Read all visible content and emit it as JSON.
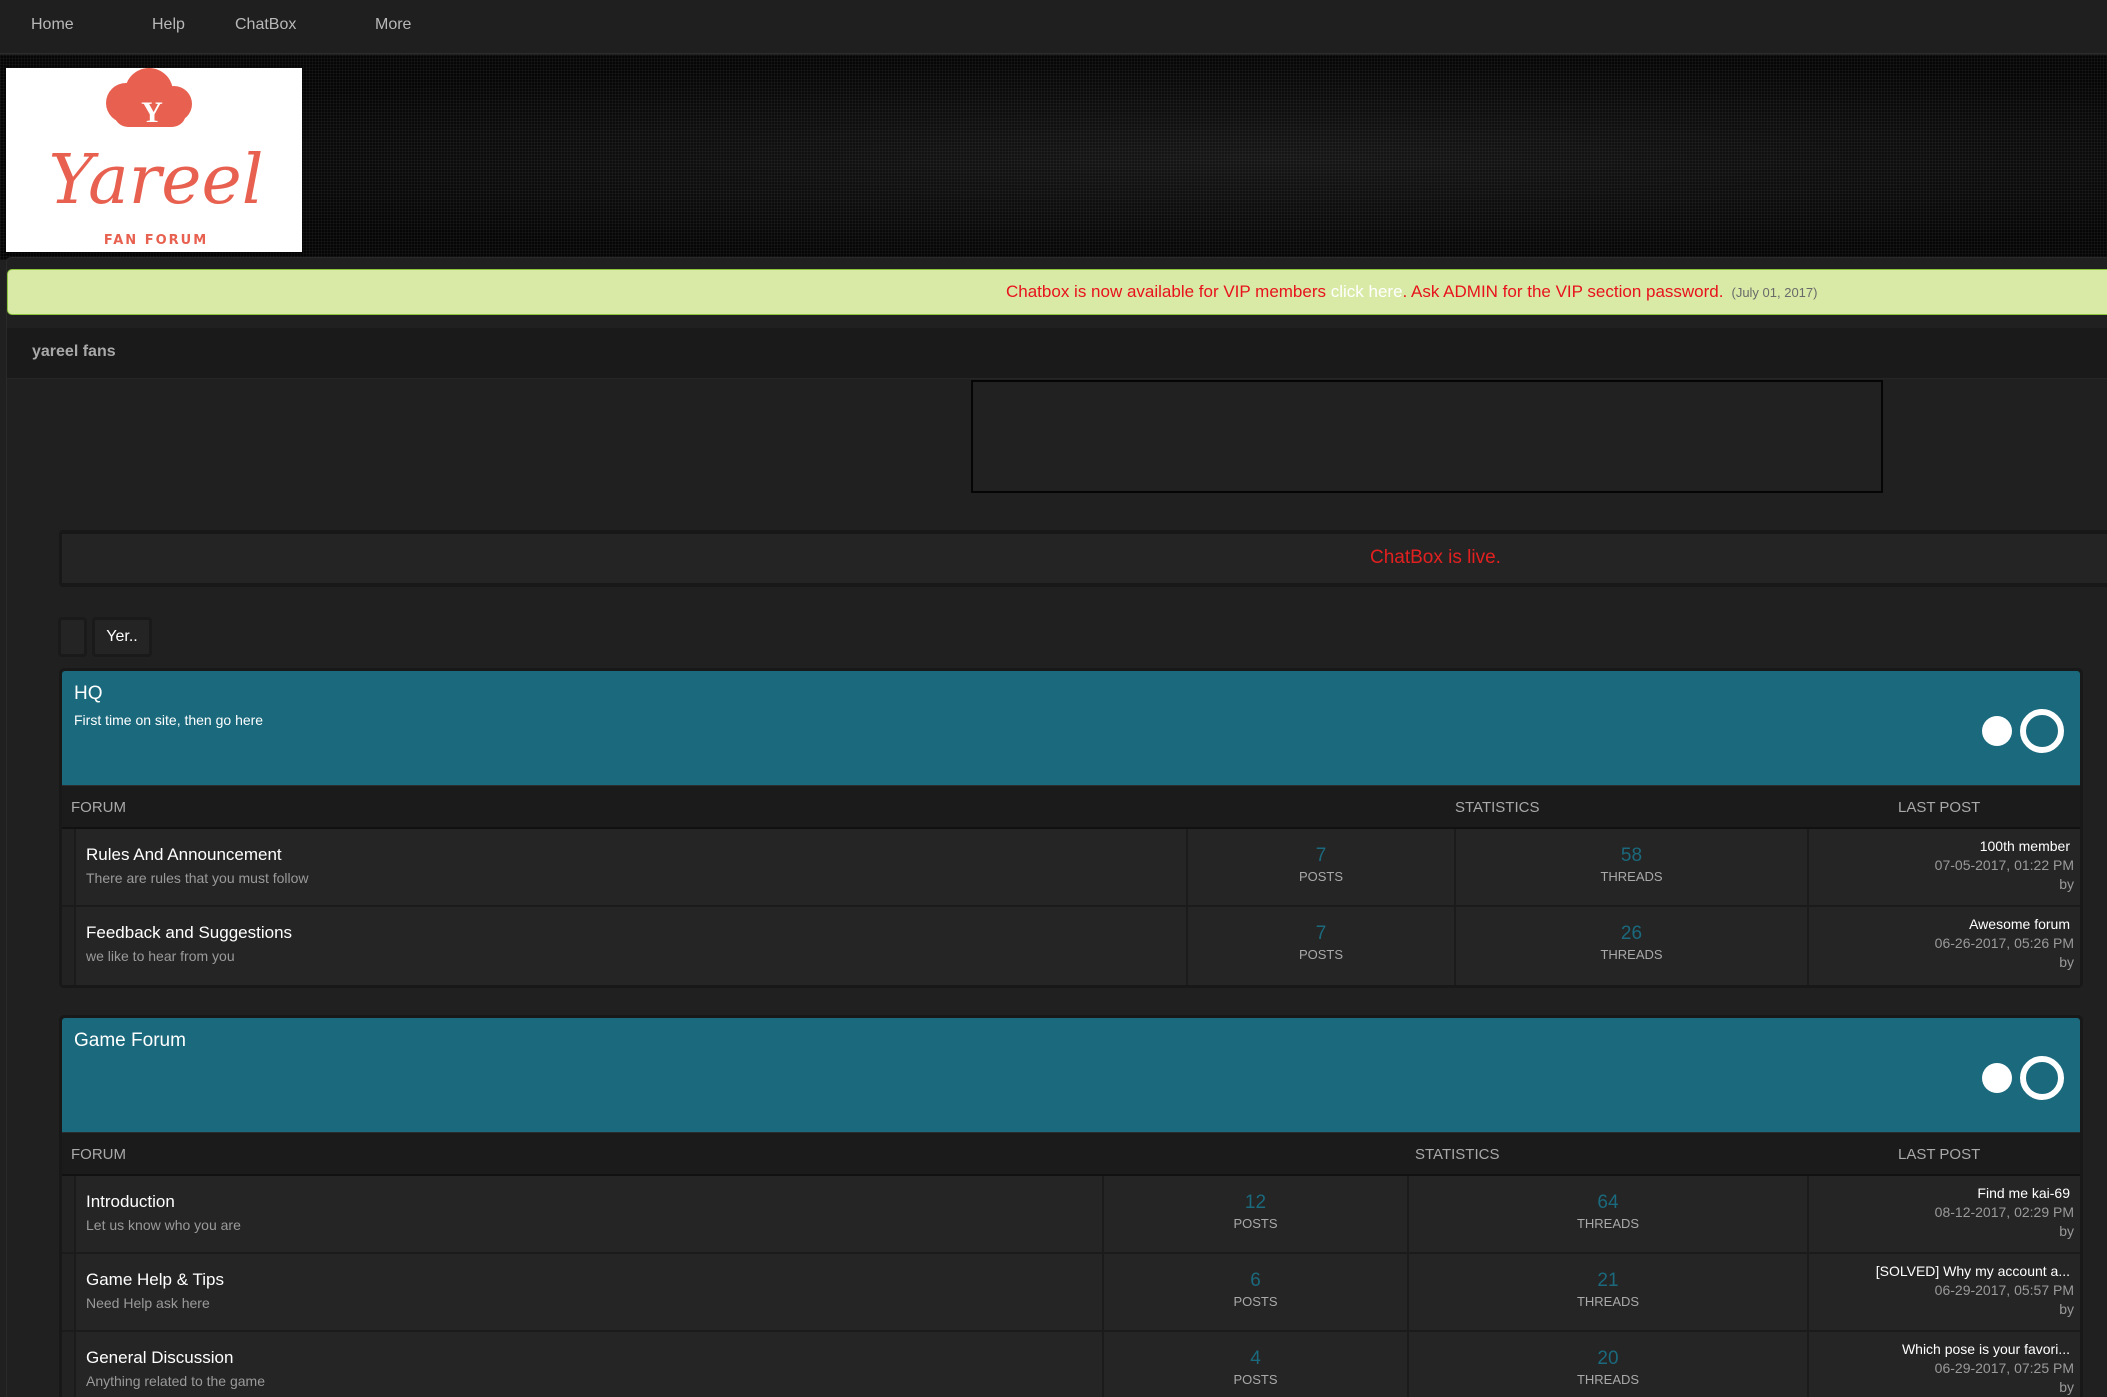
{
  "nav": {
    "items": [
      {
        "label": "Home"
      },
      {
        "label": "Help"
      },
      {
        "label": "ChatBox"
      },
      {
        "label": "More"
      }
    ]
  },
  "logo": {
    "letter": "Y",
    "name": "Yareel",
    "tagline": "FAN FORUM",
    "brand_color": "#e8604f"
  },
  "announcement": {
    "text_before": "Chatbox is now available for VIP members ",
    "link_text": "click here",
    "text_after": ". Ask ADMIN for the VIP section password.",
    "date": "(July 01, 2017)"
  },
  "breadcrumb": "yareel fans",
  "chatbox_notice": "ChatBox is live.",
  "pagination": {
    "buttons": [
      {
        "label": ""
      },
      {
        "label": "Yer.."
      }
    ]
  },
  "columns": {
    "forum": "FORUM",
    "statistics": "STATISTICS",
    "last_post": "LAST POST"
  },
  "categories": [
    {
      "title": "HQ",
      "description": "First time on site, then go here",
      "forums": [
        {
          "title": "Rules And Announcement",
          "description": "There are rules that you must follow",
          "posts": "7",
          "posts_label": "POSTS",
          "threads": "58",
          "threads_label": "THREADS",
          "last_post": {
            "title": "100th member",
            "date": "07-05-2017, 01:22 PM",
            "by": "by"
          }
        },
        {
          "title": "Feedback and Suggestions",
          "description": "we like to hear from you",
          "posts": "7",
          "posts_label": "POSTS",
          "threads": "26",
          "threads_label": "THREADS",
          "last_post": {
            "title": "Awesome forum",
            "date": "06-26-2017, 05:26 PM",
            "by": "by"
          }
        }
      ]
    },
    {
      "title": "Game Forum",
      "description": "",
      "forums": [
        {
          "title": "Introduction",
          "description": "Let us know who you are",
          "posts": "12",
          "posts_label": "POSTS",
          "threads": "64",
          "threads_label": "THREADS",
          "last_post": {
            "title": "Find me kai-69",
            "date": "08-12-2017, 02:29 PM",
            "by": "by"
          }
        },
        {
          "title": "Game Help & Tips",
          "description": "Need Help ask here",
          "posts": "6",
          "posts_label": "POSTS",
          "threads": "21",
          "threads_label": "THREADS",
          "last_post": {
            "title": "[SOLVED] Why my account a...",
            "date": "06-29-2017, 05:57 PM",
            "by": "by"
          }
        },
        {
          "title": "General Discussion",
          "description": "Anything related to the game",
          "posts": "4",
          "posts_label": "POSTS",
          "threads": "20",
          "threads_label": "THREADS",
          "last_post": {
            "title": "Which pose is your favori...",
            "date": "06-29-2017, 07:25 PM",
            "by": "by"
          }
        }
      ]
    }
  ],
  "colors": {
    "accent": "#1a697d",
    "announce_bg": "#d8eaa6",
    "announce_text": "#e8121b",
    "notice_text": "#e32020"
  }
}
